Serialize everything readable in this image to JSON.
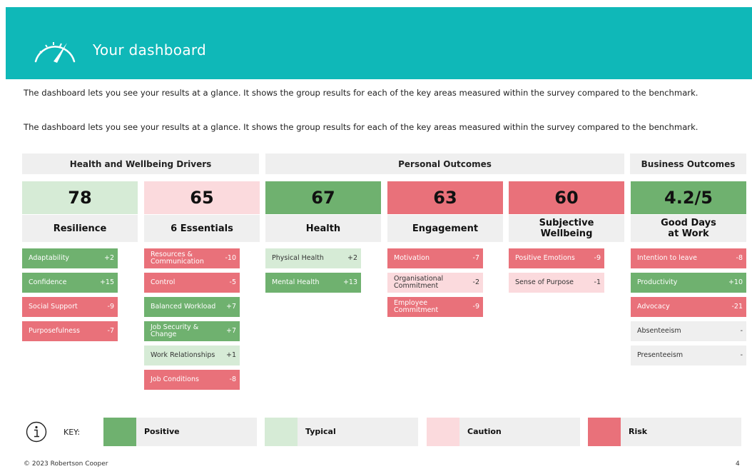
{
  "header": {
    "title": "Your dashboard"
  },
  "intro": {
    "p1": "The dashboard lets you see your results at a glance. It shows the group results for each of the key areas measured within the survey compared to the benchmark.",
    "p2": "The dashboard lets you see your results at a glance. It shows the group results for each of the key areas measured within the survey compared to the benchmark."
  },
  "sections": {
    "drivers": "Health and Wellbeing Drivers",
    "personal": "Personal Outcomes",
    "business": "Business Outcomes"
  },
  "colors": {
    "positive": "#6fb16f",
    "typical": "#d6ebd6",
    "caution": "#fbdadd",
    "risk": "#e9717a",
    "header": "#0fb8b8"
  },
  "columns": [
    {
      "score": "78",
      "label": "Resilience",
      "status": "typical",
      "items": [
        {
          "name": "Adaptability",
          "value": "+2",
          "status": "positive"
        },
        {
          "name": "Confidence",
          "value": "+15",
          "status": "positive"
        },
        {
          "name": "Social Support",
          "value": "-9",
          "status": "risk"
        },
        {
          "name": "Purposefulness",
          "value": "-7",
          "status": "risk"
        }
      ]
    },
    {
      "score": "65",
      "label": "6 Essentials",
      "status": "caution",
      "items": [
        {
          "name": "Resources & Communication",
          "value": "-10",
          "status": "risk"
        },
        {
          "name": "Control",
          "value": "-5",
          "status": "risk"
        },
        {
          "name": "Balanced Workload",
          "value": "+7",
          "status": "positive"
        },
        {
          "name": "Job Security & Change",
          "value": "+7",
          "status": "positive"
        },
        {
          "name": "Work Relationships",
          "value": "+1",
          "status": "typical"
        },
        {
          "name": "Job Conditions",
          "value": "-8",
          "status": "risk"
        }
      ]
    },
    {
      "score": "67",
      "label": "Health",
      "status": "positive",
      "items": [
        {
          "name": "Physical Health",
          "value": "+2",
          "status": "typical"
        },
        {
          "name": "Mental Health",
          "value": "+13",
          "status": "positive"
        }
      ]
    },
    {
      "score": "63",
      "label": "Engagement",
      "status": "risk",
      "items": [
        {
          "name": "Motivation",
          "value": "-7",
          "status": "risk"
        },
        {
          "name": "Organisational Commitment",
          "value": "-2",
          "status": "caution"
        },
        {
          "name": "Employee Commitment",
          "value": "-9",
          "status": "risk"
        }
      ]
    },
    {
      "score": "60",
      "label": "Subjective Wellbeing",
      "status": "risk",
      "items": [
        {
          "name": "Positive Emotions",
          "value": "-9",
          "status": "risk"
        },
        {
          "name": "Sense of Purpose",
          "value": "-1",
          "status": "caution"
        }
      ]
    },
    {
      "score": "4.2/5",
      "label": "Good Days at Work",
      "status": "positive",
      "items": [
        {
          "name": "Intention to leave",
          "value": "-8",
          "status": "risk"
        },
        {
          "name": "Productivity",
          "value": "+10",
          "status": "positive"
        },
        {
          "name": "Advocacy",
          "value": "-21",
          "status": "risk"
        },
        {
          "name": "Absenteeism",
          "value": "-",
          "status": "neutral"
        },
        {
          "name": "Presenteeism",
          "value": "-",
          "status": "neutral"
        }
      ]
    }
  ],
  "key": {
    "label": "KEY:",
    "entries": [
      {
        "text": "Positive",
        "status": "positive"
      },
      {
        "text": "Typical",
        "status": "typical"
      },
      {
        "text": "Caution",
        "status": "caution"
      },
      {
        "text": "Risk",
        "status": "risk"
      }
    ]
  },
  "footer": {
    "copyright": "© 2023 Robertson Cooper",
    "page": "4"
  }
}
